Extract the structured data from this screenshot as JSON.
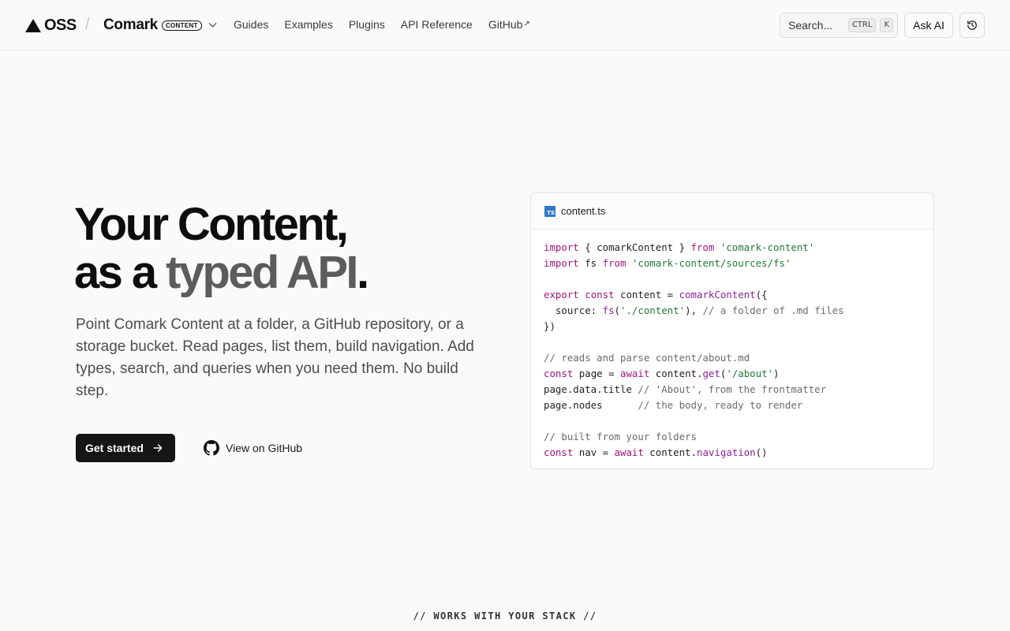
{
  "header": {
    "brand": "OSS",
    "separator": "/",
    "product": "Comark",
    "product_badge": "CONTENT",
    "nav": [
      "Guides",
      "Examples",
      "Plugins",
      "API Reference",
      "GitHub"
    ],
    "external_mark": "↗",
    "search_placeholder": "Search...",
    "shortcut_keys": [
      "CTRL",
      "K"
    ],
    "ask_ai": "Ask AI"
  },
  "hero": {
    "title_line1": "Your Content,",
    "title_line2_prefix": "as a ",
    "title_line2_highlight": "typed API",
    "title_line2_suffix": ".",
    "lead": "Point Comark Content at a folder, a GitHub repository, or a storage bucket. Read pages, list them, build navigation. Add types, search, and queries when you need them. No build step.",
    "primary_cta": "Get started",
    "secondary_cta": "View on GitHub"
  },
  "code": {
    "badge": "TS",
    "filename": "content.ts",
    "lines": [
      [
        [
          "kw",
          "import"
        ],
        [
          "tx",
          " { comarkContent } "
        ],
        [
          "kw",
          "from"
        ],
        [
          "tx",
          " "
        ],
        [
          "str",
          "'comark-content'"
        ]
      ],
      [
        [
          "kw",
          "import"
        ],
        [
          "tx",
          " fs "
        ],
        [
          "kw",
          "from"
        ],
        [
          "tx",
          " "
        ],
        [
          "str",
          "'comark-content/sources/fs'"
        ]
      ],
      [],
      [
        [
          "kw",
          "export"
        ],
        [
          "tx",
          " "
        ],
        [
          "kw",
          "const"
        ],
        [
          "tx",
          " content = "
        ],
        [
          "fn",
          "comarkContent"
        ],
        [
          "tx",
          "({"
        ]
      ],
      [
        [
          "tx",
          "  source: "
        ],
        [
          "fn",
          "fs"
        ],
        [
          "tx",
          "("
        ],
        [
          "str",
          "'./content'"
        ],
        [
          "tx",
          "), "
        ],
        [
          "cm",
          "// a folder of .md files"
        ]
      ],
      [
        [
          "tx",
          "})"
        ]
      ],
      [],
      [
        [
          "cm",
          "// reads and parse content/about.md"
        ]
      ],
      [
        [
          "kw",
          "const"
        ],
        [
          "tx",
          " page = "
        ],
        [
          "kw",
          "await"
        ],
        [
          "tx",
          " content."
        ],
        [
          "fn",
          "get"
        ],
        [
          "tx",
          "("
        ],
        [
          "str",
          "'/about'"
        ],
        [
          "tx",
          ")"
        ]
      ],
      [
        [
          "tx",
          "page.data.title "
        ],
        [
          "cm",
          "// 'About', from the frontmatter"
        ]
      ],
      [
        [
          "tx",
          "page.nodes      "
        ],
        [
          "cm",
          "// the body, ready to render"
        ]
      ],
      [],
      [
        [
          "cm",
          "// built from your folders"
        ]
      ],
      [
        [
          "kw",
          "const"
        ],
        [
          "tx",
          " nav = "
        ],
        [
          "kw",
          "await"
        ],
        [
          "tx",
          " content."
        ],
        [
          "fn",
          "navigation"
        ],
        [
          "tx",
          "()"
        ]
      ]
    ]
  },
  "footer_teaser": "// WORKS WITH YOUR STACK //",
  "colors": {
    "background": "#fafafa",
    "primary_button": "#151515",
    "keyword": "#a0157a",
    "string": "#227a35",
    "function": "#8c1f9e",
    "comment": "#6b6b6b",
    "ts_badge": "#3178c6"
  },
  "icons": [
    "logo-triangle-icon",
    "chevron-down-icon",
    "external-link-icon",
    "history-icon",
    "arrow-right-icon",
    "github-icon",
    "typescript-file-icon"
  ]
}
